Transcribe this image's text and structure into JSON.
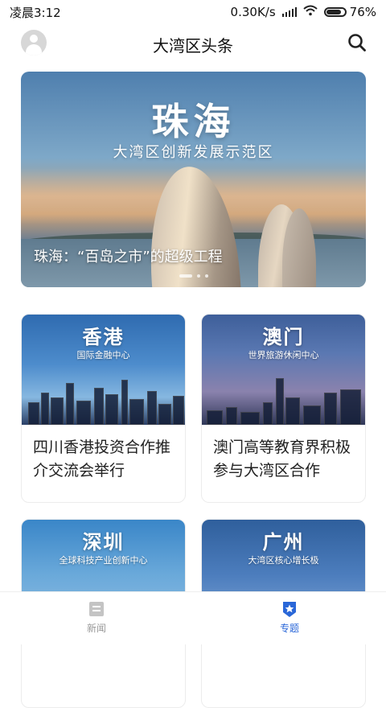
{
  "status_bar": {
    "time": "凌晨3:12",
    "net_speed": "0.30K/s",
    "battery": "76%"
  },
  "header": {
    "title": "大湾区头条"
  },
  "hero": {
    "title": "珠海",
    "subtitle": "大湾区创新发展示范区",
    "caption": "珠海：“百岛之市”的超级工程",
    "pagination": {
      "count": 3,
      "active": 0
    }
  },
  "cards": [
    {
      "city": "香港",
      "tagline": "国际金融中心",
      "text": "四川香港投资合作推介交流会举行"
    },
    {
      "city": "澳门",
      "tagline": "世界旅游休闲中心",
      "text": "澳门高等教育界积极参与大湾区合作"
    },
    {
      "city": "深圳",
      "tagline": "全球科技产业创新中心",
      "text": ""
    },
    {
      "city": "广州",
      "tagline": "大湾区核心增长极",
      "text": ""
    }
  ],
  "tabbar": {
    "tabs": [
      {
        "label": "新闻",
        "icon": "news-icon",
        "active": false
      },
      {
        "label": "专题",
        "icon": "topic-star-shield-icon",
        "active": true
      }
    ]
  },
  "colors": {
    "accent": "#2a67d8",
    "inactive_tab": "#999999"
  }
}
